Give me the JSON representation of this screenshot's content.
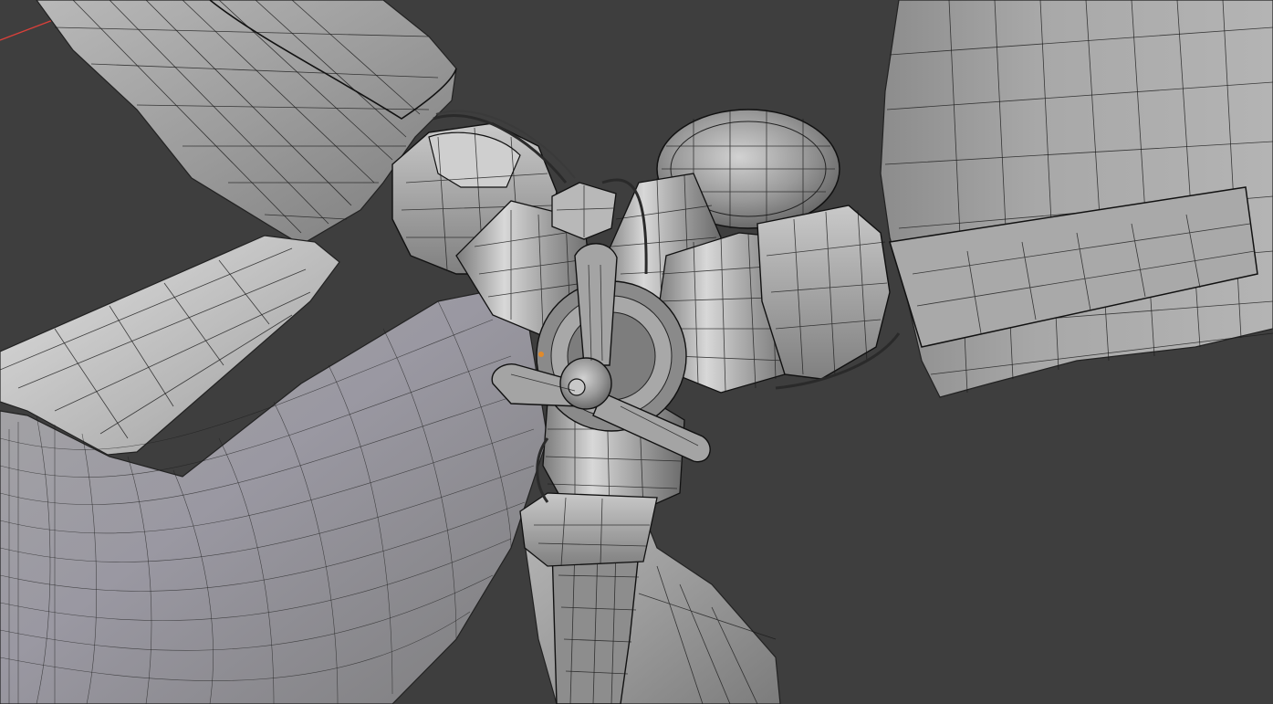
{
  "viewport": {
    "background": "#3e3e3e",
    "mesh_color": "#9a9a9a",
    "wire_color": "#1a1a1a",
    "axis_color": "#d9403a",
    "shading": "solid-wireframe-overlay",
    "subject": ""
  },
  "overlay": {
    "has_text": false
  }
}
